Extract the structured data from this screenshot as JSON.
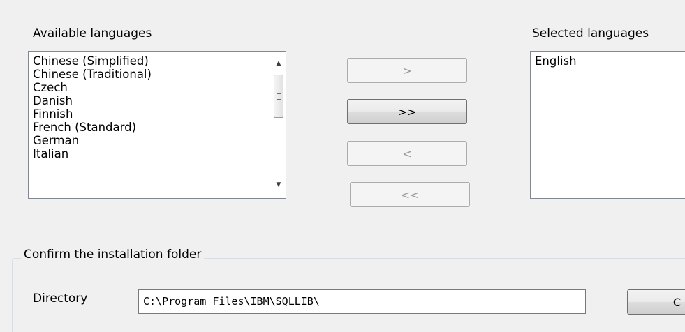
{
  "available": {
    "label": "Available languages",
    "items": [
      "Chinese (Simplified)",
      "Chinese (Traditional)",
      "Czech",
      "Danish",
      "Finnish",
      "French (Standard)",
      "German",
      "Italian"
    ]
  },
  "selected": {
    "label": "Selected languages",
    "items": [
      "English"
    ]
  },
  "buttons": {
    "add": ">",
    "add_all": ">>",
    "remove": "<",
    "remove_all": "<<"
  },
  "folder": {
    "group_title": "Confirm the installation folder",
    "directory_label": "Directory",
    "directory_value": "C:\\Program Files\\IBM\\SQLLIB\\",
    "change_button": "C"
  },
  "icons": {
    "scroll_up": "triangle-up",
    "scroll_down": "triangle-down"
  }
}
